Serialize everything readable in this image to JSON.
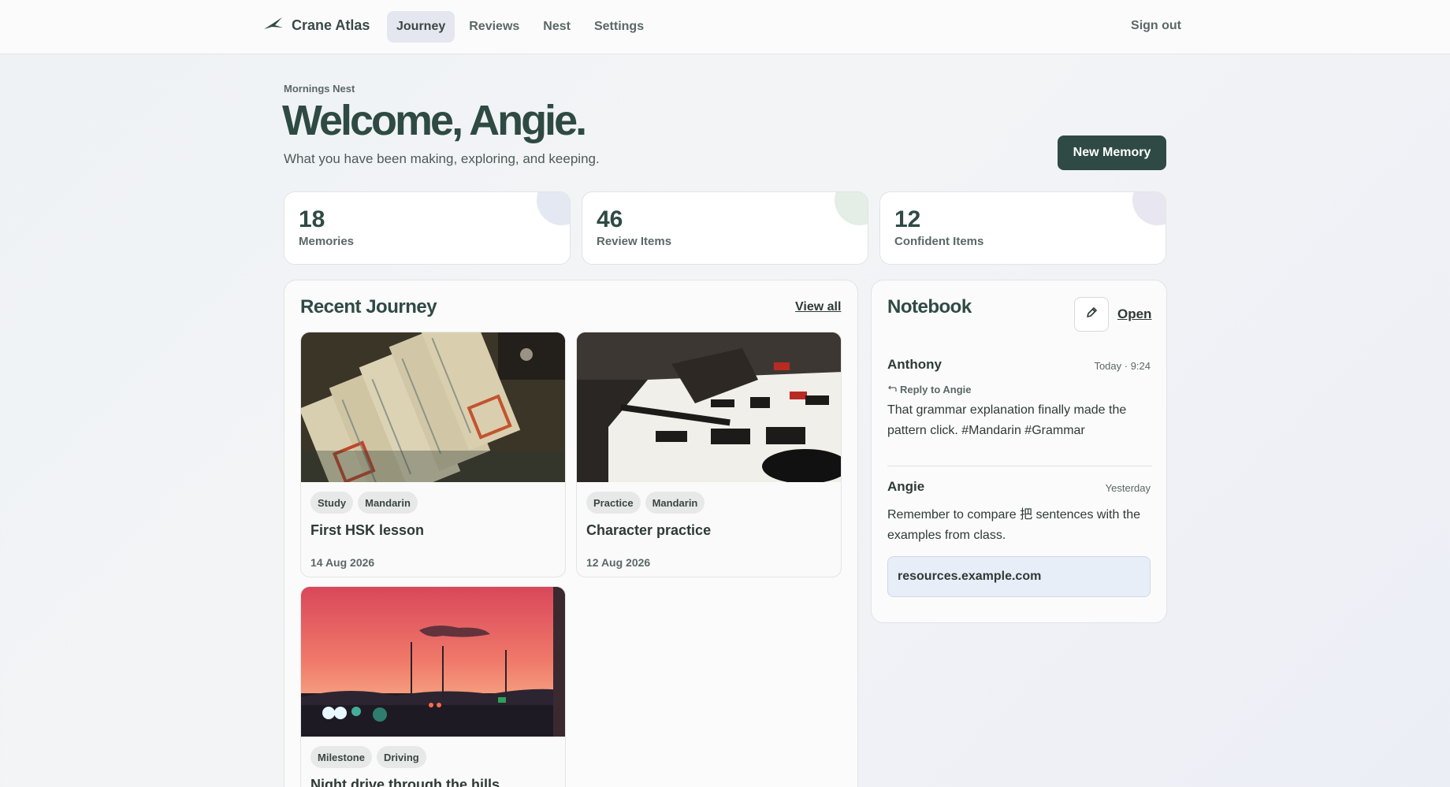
{
  "app": {
    "name": "Crane Atlas"
  },
  "nav": {
    "items": [
      {
        "label": "Journey",
        "active": true
      },
      {
        "label": "Reviews"
      },
      {
        "label": "Nest"
      },
      {
        "label": "Settings"
      }
    ],
    "signout": "Sign out"
  },
  "hero": {
    "eyebrow": "Mornings Nest",
    "title": "Welcome, Angie.",
    "subtitle": "What you have been making, exploring, and keeping.",
    "cta": "New Memory"
  },
  "stats": [
    {
      "value": "18",
      "label": "Memories"
    },
    {
      "value": "46",
      "label": "Review Items"
    },
    {
      "value": "12",
      "label": "Confident Items"
    }
  ],
  "journey": {
    "title": "Recent Journey",
    "view_all": "View all",
    "cards": [
      {
        "tags": [
          "Study",
          "Mandarin"
        ],
        "title": "First HSK lesson",
        "date": "14 Aug 2026"
      },
      {
        "tags": [
          "Practice",
          "Mandarin"
        ],
        "title": "Character practice",
        "date": "12 Aug 2026"
      },
      {
        "tags": [
          "Milestone",
          "Driving"
        ],
        "title": "Night drive through the hills",
        "date": ""
      }
    ]
  },
  "notebook": {
    "title": "Notebook",
    "open": "Open",
    "entries": [
      {
        "author": "Anthony",
        "time": "Today · 9:24",
        "reply": "Reply to Angie",
        "text": "That grammar explanation finally made the pattern click. #Mandarin #Grammar"
      },
      {
        "author": "Angie",
        "time": "Yesterday",
        "text": "Remember to compare 把 sentences with the examples from class.",
        "link": "resources.example.com"
      }
    ]
  },
  "colors": {
    "accent": "#2f4a44",
    "stat_deco": [
      "#e3e8f3",
      "#e4ede6",
      "#e8e6f1"
    ]
  }
}
